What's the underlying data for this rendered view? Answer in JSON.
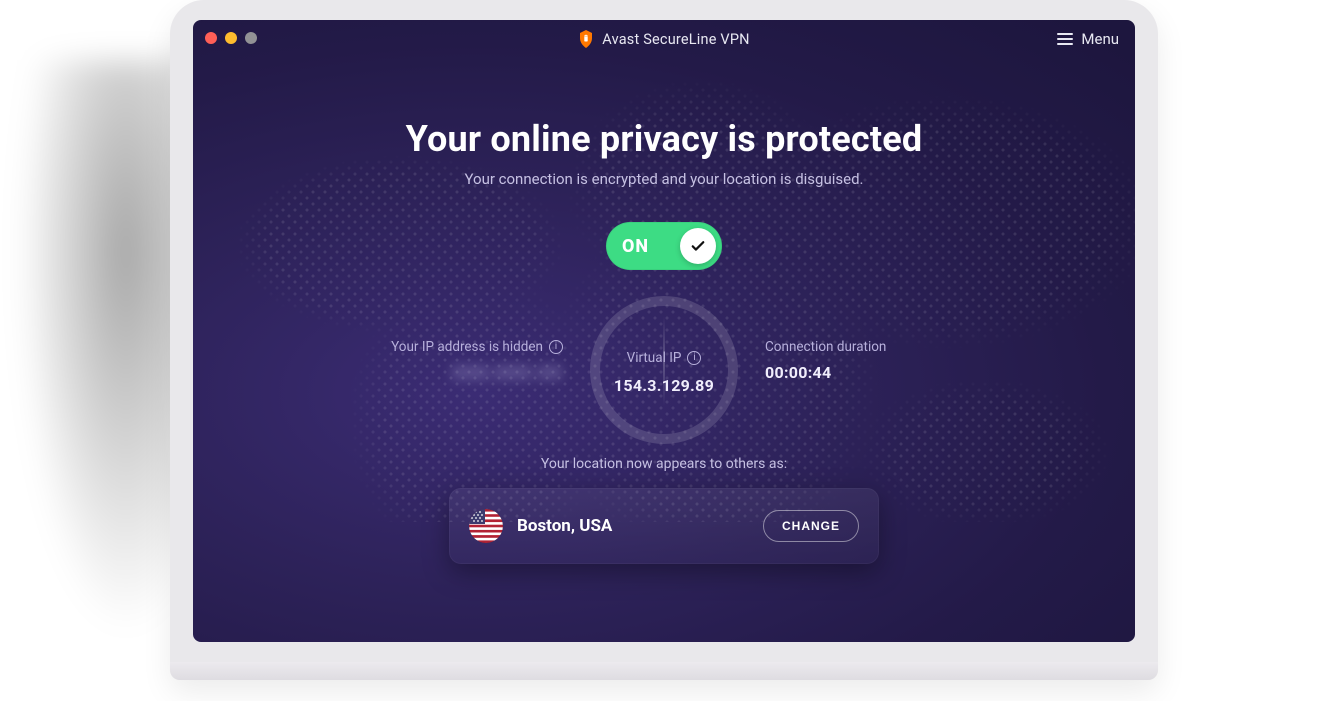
{
  "titlebar": {
    "app_name": "Avast SecureLine VPN",
    "menu_label": "Menu"
  },
  "hero": {
    "headline": "Your online privacy is protected",
    "subtitle": "Your connection is encrypted and your location is disguised."
  },
  "toggle": {
    "state_label": "ON",
    "on": true
  },
  "status": {
    "hidden_ip_label": "Your IP address is hidden",
    "hidden_ip_value": "XXX.XXX.XX",
    "virtual_ip_label": "Virtual IP",
    "virtual_ip_value": "154.3.129.89",
    "duration_label": "Connection duration",
    "duration_value": "00:00:44"
  },
  "location": {
    "intro": "Your location now appears to others as:",
    "name": "Boston, USA",
    "change_label": "CHANGE",
    "flag": "us"
  },
  "colors": {
    "bg_deep": "#231a48",
    "bg_light": "#472f7e",
    "accent_green": "#3ddc84",
    "text_muted": "#b7b0db"
  }
}
